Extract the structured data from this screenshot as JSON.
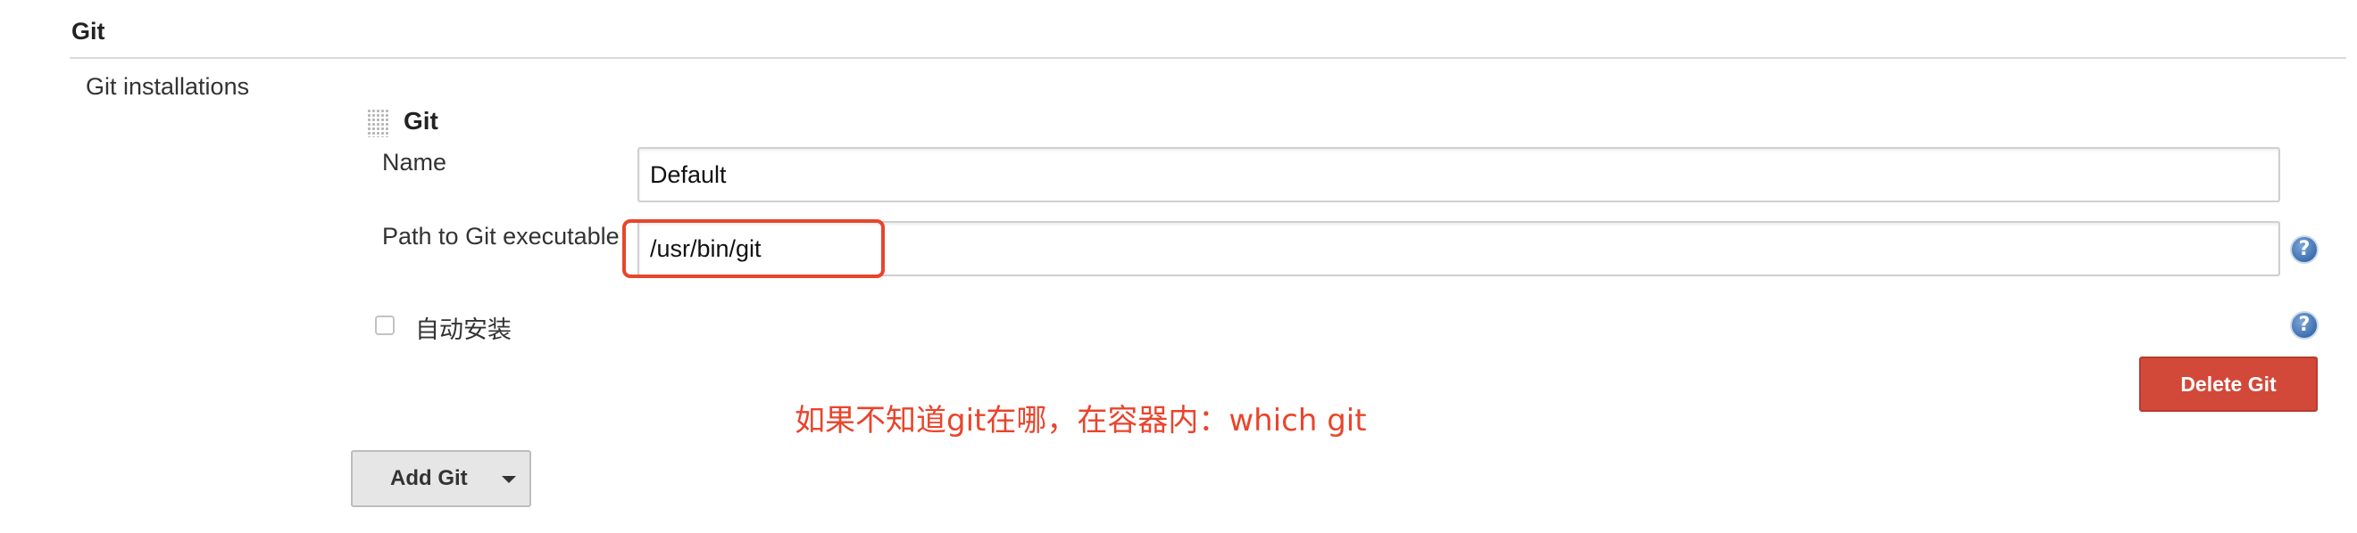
{
  "section": {
    "title": "Git"
  },
  "installations": {
    "label": "Git installations",
    "item": {
      "title": "Git",
      "name_label": "Name",
      "name_value": "Default",
      "path_label": "Path to Git executable",
      "path_value": "/usr/bin/git",
      "auto_install_label": "自动安装",
      "auto_install_checked": false,
      "delete_label": "Delete Git",
      "help_icon": "help-icon"
    },
    "add_label": "Add Git"
  },
  "annotation": {
    "text": "如果不知道git在哪，在容器内：which git",
    "color": "#e8452c"
  },
  "colors": {
    "delete_button": "#d24939",
    "highlight": "#e8452c",
    "help_icon": "#3d6fb0"
  }
}
